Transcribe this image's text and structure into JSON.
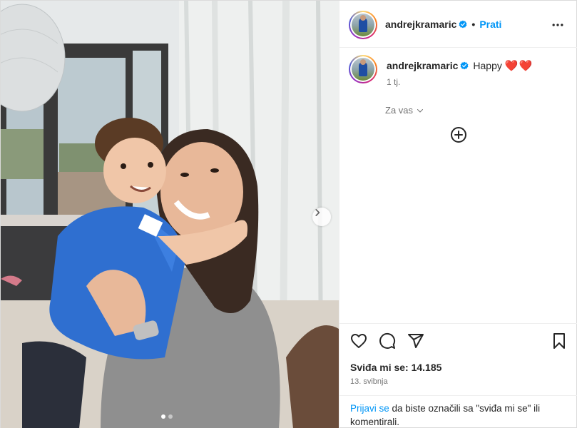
{
  "post": {
    "username": "andrejkramaric",
    "follow_label": "Prati",
    "separator": "•",
    "caption_text": "Happy",
    "caption_emoji": "❤️❤️",
    "time_ago": "1 tj.",
    "for_you_label": "Za vas",
    "likes_label": "Sviđa mi se: 14.185",
    "date_label": "13. svibnja",
    "login_link": "Prijavi se",
    "login_text": " da biste označili sa \"sviđa mi se\" ili komentirali.",
    "carousel": {
      "current": 1,
      "total": 2
    }
  },
  "colors": {
    "accent": "#0095f6",
    "heart": "#e0245e",
    "verified": "#0095f6",
    "secondary_text": "#737373"
  },
  "icons": {
    "more": "more-options-icon",
    "verified": "verified-badge-icon",
    "next": "chevron-right-icon",
    "add": "add-circle-icon",
    "like": "heart-icon",
    "comment": "comment-icon",
    "share": "share-icon",
    "save": "bookmark-icon"
  }
}
